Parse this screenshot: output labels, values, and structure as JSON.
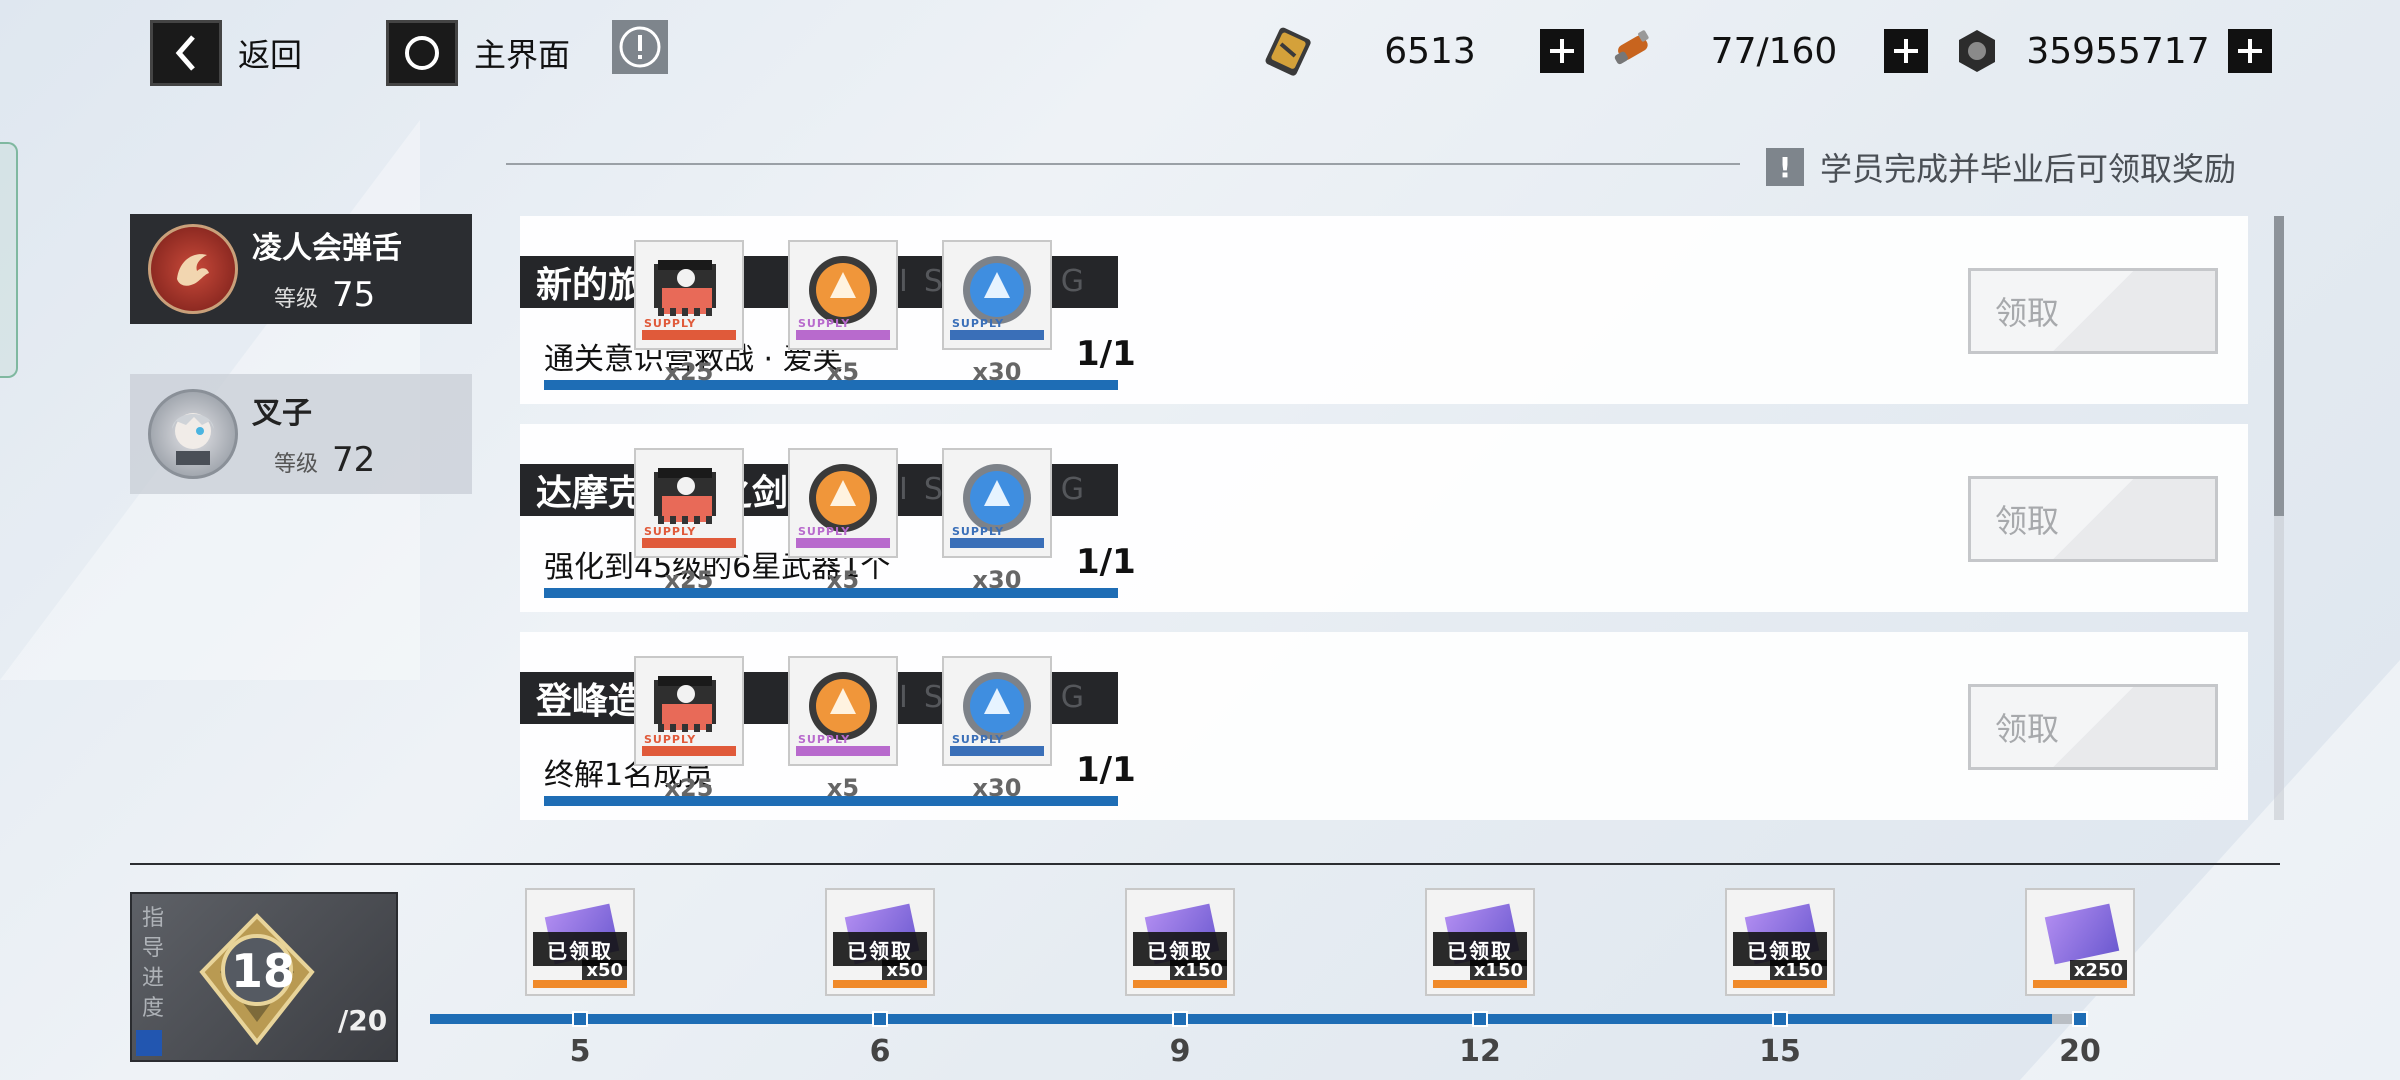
{
  "nav": {
    "back_label": "返回",
    "home_label": "主界面",
    "info_label": "!"
  },
  "resources": [
    {
      "icon": "stamina-card-icon",
      "value": "6513"
    },
    {
      "icon": "blood-serum-icon",
      "value": "77/160"
    },
    {
      "icon": "gear-coin-icon",
      "value": "35955717"
    }
  ],
  "notice": {
    "icon_label": "!",
    "text": "学员完成并毕业后可领取奖励"
  },
  "students": [
    {
      "name": "凌人会弹舌",
      "level_label": "等级",
      "level": "75",
      "active": true
    },
    {
      "name": "叉子",
      "level_label": "等级",
      "level": "72",
      "active": false
    }
  ],
  "tasks": [
    {
      "title": "新的旅途",
      "deco": "PUNISHING",
      "description": "通关意识营救战 · 爱芙",
      "progress": "1/1",
      "progress_fraction": 1.0,
      "rewards": [
        {
          "icon": "memory-chip-icon",
          "supply_label": "SUPPLY",
          "count": "x25",
          "color": "#e05a3a"
        },
        {
          "icon": "orange-coin-icon",
          "supply_label": "SUPPLY",
          "count": "x5",
          "color": "#b86acd"
        },
        {
          "icon": "blue-coin-icon",
          "supply_label": "SUPPLY",
          "count": "x30",
          "color": "#3a6fb8"
        }
      ],
      "claim_label": "领取"
    },
    {
      "title": "达摩克利斯之剑",
      "deco": "PUNISHING",
      "description": "强化到45级的6星武器1个",
      "progress": "1/1",
      "progress_fraction": 1.0,
      "rewards": [
        {
          "icon": "memory-chip-icon",
          "supply_label": "SUPPLY",
          "count": "x25",
          "color": "#e05a3a"
        },
        {
          "icon": "orange-coin-icon",
          "supply_label": "SUPPLY",
          "count": "x5",
          "color": "#b86acd"
        },
        {
          "icon": "blue-coin-icon",
          "supply_label": "SUPPLY",
          "count": "x30",
          "color": "#3a6fb8"
        }
      ],
      "claim_label": "领取"
    },
    {
      "title": "登峰造极",
      "deco": "PUNISHING",
      "description": "终解1名成员",
      "progress": "1/1",
      "progress_fraction": 1.0,
      "rewards": [
        {
          "icon": "memory-chip-icon",
          "supply_label": "SUPPLY",
          "count": "x25",
          "color": "#e05a3a"
        },
        {
          "icon": "orange-coin-icon",
          "supply_label": "SUPPLY",
          "count": "x5",
          "color": "#b86acd"
        },
        {
          "icon": "blue-coin-icon",
          "supply_label": "SUPPLY",
          "count": "x30",
          "color": "#3a6fb8"
        }
      ],
      "claim_label": "领取"
    }
  ],
  "guide": {
    "label": "指导进度",
    "current": "18",
    "total": "/20",
    "progress_fraction": 0.9
  },
  "milestones": [
    {
      "threshold": "5",
      "count": "x50",
      "claimed_label": "已领取",
      "claimed": true
    },
    {
      "threshold": "6",
      "count": "x50",
      "claimed_label": "已领取",
      "claimed": true
    },
    {
      "threshold": "9",
      "count": "x150",
      "claimed_label": "已领取",
      "claimed": true
    },
    {
      "threshold": "12",
      "count": "x150",
      "claimed_label": "已领取",
      "claimed": true
    },
    {
      "threshold": "15",
      "count": "x150",
      "claimed_label": "已领取",
      "claimed": true
    },
    {
      "threshold": "20",
      "count": "x250",
      "claimed_label": "",
      "claimed": false
    }
  ],
  "colors": {
    "accent_blue": "#1e6db5",
    "dark_panel": "#2b2d31"
  }
}
